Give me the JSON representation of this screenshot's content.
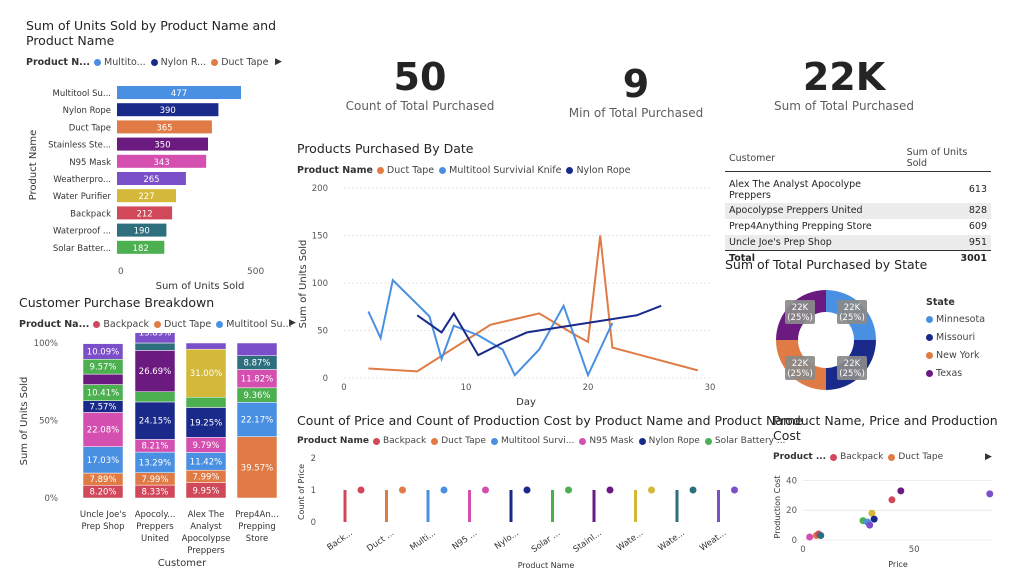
{
  "units_chart": {
    "title": "Sum of Units Sold by Product Name and Product Name",
    "legend_title": "Product N...",
    "legend": [
      {
        "name": "Multito...",
        "color": "#4a90e2"
      },
      {
        "name": "Nylon R...",
        "color": "#1a2a8a"
      },
      {
        "name": "Duct Tape",
        "color": "#e07b45"
      }
    ],
    "xlabel": "Sum of Units Sold",
    "ylabel": "Product Name",
    "ticks": [
      "0",
      "500"
    ]
  },
  "kpis": [
    {
      "value": "50",
      "label": "Count of Total Purchased"
    },
    {
      "value": "9",
      "label": "Min of Total Purchased"
    },
    {
      "value": "22K",
      "label": "Sum of Total Purchased"
    }
  ],
  "line_chart": {
    "title": "Products Purchased By Date",
    "legend_title": "Product Name",
    "legend": [
      {
        "name": "Duct Tape",
        "color": "#e07b45"
      },
      {
        "name": "Multitool Survivial Knife",
        "color": "#4a90e2"
      },
      {
        "name": "Nylon Rope",
        "color": "#1a2a8a"
      }
    ],
    "xlabel": "Day",
    "ylabel": "Sum of Units Sold",
    "yticks": [
      "200",
      "150",
      "100",
      "50",
      "0"
    ],
    "xticks": [
      "0",
      "10",
      "20",
      "30"
    ]
  },
  "customer_table": {
    "headers": [
      "Customer",
      "Sum of Units Sold"
    ],
    "rows": [
      {
        "name": "Alex The Analyst Apocolype Preppers",
        "value": "613"
      },
      {
        "name": "Apocolypse Preppers United",
        "value": "828"
      },
      {
        "name": "Prep4Anything Prepping Store",
        "value": "609"
      },
      {
        "name": "Uncle Joe's Prep Shop",
        "value": "951"
      }
    ],
    "total_label": "Total",
    "total_value": "3001"
  },
  "donut": {
    "title": "Sum of Total Purchased by State",
    "legend_title": "State",
    "labels": [
      {
        "line1": "22K",
        "line2": "(25%)"
      },
      {
        "line1": "22K",
        "line2": "(25%)"
      },
      {
        "line1": "22K",
        "line2": "(25%)"
      },
      {
        "line1": "22K",
        "line2": "(25%)"
      }
    ],
    "legend": [
      {
        "name": "Minnesota",
        "color": "#4a90e2"
      },
      {
        "name": "Missouri",
        "color": "#1a2a8a"
      },
      {
        "name": "New York",
        "color": "#e07b45"
      },
      {
        "name": "Texas",
        "color": "#6b1a80"
      }
    ]
  },
  "stacked": {
    "title": "Customer Purchase Breakdown",
    "legend_title": "Product Na...",
    "legend": [
      {
        "name": "Backpack",
        "color": "#d0485a"
      },
      {
        "name": "Duct Tape",
        "color": "#e07b45"
      },
      {
        "name": "Multitool Su...",
        "color": "#4a90e2"
      }
    ],
    "xlabel": "Customer",
    "ylabel": "Sum of Units Sold",
    "yticks": [
      "100%",
      "50%",
      "0%"
    ],
    "categories": [
      {
        "l1": "Uncle Joe's",
        "l2": "Prep Shop",
        "l3": "",
        "l4": ""
      },
      {
        "l1": "Apocoly...",
        "l2": "Preppers",
        "l3": "United",
        "l4": ""
      },
      {
        "l1": "Alex The",
        "l2": "Analyst",
        "l3": "Apocolypse",
        "l4": "Preppers"
      },
      {
        "l1": "Prep4An...",
        "l2": "Prepping",
        "l3": "Store",
        "l4": ""
      }
    ]
  },
  "count_chart": {
    "title": "Count of Price and Count of Production Cost by Product Name and Product Name",
    "legend_title": "Product Name",
    "legend": [
      {
        "name": "Backpack",
        "color": "#d0485a"
      },
      {
        "name": "Duct Tape",
        "color": "#e07b45"
      },
      {
        "name": "Multitool Survi...",
        "color": "#4a90e2"
      },
      {
        "name": "N95 Mask",
        "color": "#d44fb0"
      },
      {
        "name": "Nylon Rope",
        "color": "#1a2a8a"
      },
      {
        "name": "Solar Battery ...",
        "color": "#4caf50"
      }
    ],
    "xlabel": "Product Name",
    "ylabel": "Count of Price",
    "yticks": [
      "2",
      "1",
      "0"
    ]
  },
  "scatter": {
    "title": "Product Name, Price and Production Cost",
    "legend_title": "Product ...",
    "legend": [
      {
        "name": "Backpack",
        "color": "#d0485a"
      },
      {
        "name": "Duct Tape",
        "color": "#e07b45"
      }
    ],
    "xlabel": "Price",
    "ylabel": "Production Cost",
    "yticks": [
      "40",
      "20",
      "0"
    ],
    "xticks": [
      "0",
      "50"
    ]
  },
  "chart_data": [
    {
      "type": "bar",
      "title": "Sum of Units Sold by Product Name and Product Name",
      "xlabel": "Sum of Units Sold",
      "ylabel": "Product Name",
      "xlim": [
        0,
        550
      ],
      "categories": [
        "Multitool Su...",
        "Nylon Rope",
        "Duct Tape",
        "Stainless Ste...",
        "N95 Mask",
        "Weatherpro...",
        "Water Purifier",
        "Backpack",
        "Waterproof ...",
        "Solar Batter..."
      ],
      "values": [
        477,
        390,
        365,
        350,
        343,
        265,
        227,
        212,
        190,
        182
      ],
      "colors": [
        "#4a90e2",
        "#1a2a8a",
        "#e07b45",
        "#6b1a80",
        "#d44fb0",
        "#7b4fc9",
        "#d4b83a",
        "#d0485a",
        "#2e6f7e",
        "#4caf50"
      ]
    },
    {
      "type": "line",
      "title": "Products Purchased By Date",
      "xlabel": "Day",
      "ylabel": "Sum of Units Sold",
      "xlim": [
        0,
        30
      ],
      "ylim": [
        0,
        200
      ],
      "series": [
        {
          "name": "Duct Tape",
          "color": "#e07b45",
          "x": [
            2,
            6,
            12,
            16,
            19,
            20,
            21,
            22,
            29
          ],
          "y": [
            10,
            7,
            56,
            68,
            45,
            38,
            150,
            32,
            8
          ]
        },
        {
          "name": "Multitool Survivial Knife",
          "color": "#4a90e2",
          "x": [
            2,
            3,
            4,
            7,
            8,
            9,
            11,
            13,
            14,
            16,
            18,
            20,
            22
          ],
          "y": [
            70,
            42,
            103,
            65,
            20,
            55,
            45,
            30,
            3,
            30,
            76,
            3,
            58
          ]
        },
        {
          "name": "Nylon Rope",
          "color": "#1a2a8a",
          "x": [
            6,
            8,
            9,
            11,
            13,
            15,
            20,
            24,
            26
          ],
          "y": [
            66,
            48,
            68,
            24,
            37,
            48,
            58,
            66,
            76
          ]
        }
      ]
    },
    {
      "type": "pie",
      "title": "Sum of Total Purchased by State",
      "categories": [
        "Minnesota",
        "Missouri",
        "New York",
        "Texas"
      ],
      "values": [
        25,
        25,
        25,
        25
      ],
      "colors": [
        "#4a90e2",
        "#1a2a8a",
        "#e07b45",
        "#6b1a80"
      ]
    },
    {
      "type": "bar",
      "title": "Customer Purchase Breakdown",
      "xlabel": "Customer",
      "ylabel": "Sum of Units Sold",
      "ylim": [
        0,
        100
      ],
      "categories": [
        "Uncle Joe's Prep Shop",
        "Apocoly... Preppers United",
        "Alex The Analyst Apocolypse Preppers",
        "Prep4An... Prepping Store"
      ],
      "stacks": [
        [
          {
            "value": 8.2,
            "label": "8.20%",
            "color": "#d0485a"
          },
          {
            "value": 7.89,
            "label": "7.89%",
            "color": "#e07b45"
          },
          {
            "value": 17.03,
            "label": "17.03%",
            "color": "#4a90e2"
          },
          {
            "value": 22.08,
            "label": "22.08%",
            "color": "#d44fb0"
          },
          {
            "value": 7.57,
            "label": "7.57%",
            "color": "#1a2a8a"
          },
          {
            "value": 10.41,
            "label": "10.41%",
            "color": "#4caf50"
          },
          {
            "value": 6.74,
            "label": "",
            "color": "#6b1a80"
          },
          {
            "value": 9.57,
            "label": "9.57%",
            "color": "#4caf50"
          },
          {
            "value": 10.09,
            "label": "10.09%",
            "color": "#7b4fc9"
          }
        ],
        [
          {
            "value": 8.33,
            "label": "8.33%",
            "color": "#d0485a"
          },
          {
            "value": 7.99,
            "label": "7.99%",
            "color": "#e07b45"
          },
          {
            "value": 13.29,
            "label": "13.29%",
            "color": "#4a90e2"
          },
          {
            "value": 8.21,
            "label": "8.21%",
            "color": "#d44fb0"
          },
          {
            "value": 24.15,
            "label": "24.15%",
            "color": "#1a2a8a"
          },
          {
            "value": 6.58,
            "label": "",
            "color": "#4caf50"
          },
          {
            "value": 26.69,
            "label": "26.69%",
            "color": "#6b1a80"
          },
          {
            "value": 4.76,
            "label": "",
            "color": "#2e6f7e"
          },
          {
            "value": 13.89,
            "label": "13.89%",
            "color": "#7b4fc9"
          }
        ],
        [
          {
            "value": 9.95,
            "label": "9.95%",
            "color": "#d0485a"
          },
          {
            "value": 7.99,
            "label": "7.99%",
            "color": "#e07b45"
          },
          {
            "value": 11.42,
            "label": "11.42%",
            "color": "#4a90e2"
          },
          {
            "value": 9.79,
            "label": "9.79%",
            "color": "#d44fb0"
          },
          {
            "value": 19.25,
            "label": "19.25%",
            "color": "#1a2a8a"
          },
          {
            "value": 6.6,
            "label": "",
            "color": "#4caf50"
          },
          {
            "value": 31.0,
            "label": "31.00%",
            "color": "#d4b83a"
          },
          {
            "value": 4.0,
            "label": "",
            "color": "#7b4fc9"
          }
        ],
        [
          {
            "value": 39.57,
            "label": "39.57%",
            "color": "#e07b45"
          },
          {
            "value": 22.17,
            "label": "22.17%",
            "color": "#4a90e2"
          },
          {
            "value": 9.36,
            "label": "9.36%",
            "color": "#4caf50"
          },
          {
            "value": 11.82,
            "label": "11.82%",
            "color": "#d44fb0"
          },
          {
            "value": 8.87,
            "label": "8.87%",
            "color": "#2e6f7e"
          },
          {
            "value": 8.21,
            "label": "",
            "color": "#7b4fc9"
          }
        ]
      ]
    },
    {
      "type": "bar",
      "title": "Count of Price and Count of Production Cost by Product Name and Product Name",
      "xlabel": "Product Name",
      "ylabel": "Count of Price",
      "ylim": [
        0,
        2
      ],
      "categories": [
        "Back...",
        "Duct ...",
        "Multi...",
        "N95 ...",
        "Nylo...",
        "Solar ...",
        "Stainl...",
        "Wate...",
        "Wate...",
        "Weat..."
      ],
      "series": [
        {
          "name": "Count of Price",
          "values": [
            1,
            1,
            1,
            1,
            1,
            1,
            1,
            1,
            1,
            1
          ]
        },
        {
          "name": "Count of Production Cost",
          "values": [
            1,
            1,
            1,
            1,
            1,
            1,
            1,
            1,
            1,
            1
          ]
        }
      ],
      "colors": [
        "#d0485a",
        "#e07b45",
        "#4a90e2",
        "#d44fb0",
        "#1a2a8a",
        "#4caf50",
        "#6b1a80",
        "#d4b83a",
        "#2e6f7e",
        "#7b4fc9"
      ]
    },
    {
      "type": "scatter",
      "title": "Product Name, Price and Production Cost",
      "xlabel": "Price",
      "ylabel": "Production Cost",
      "xlim": [
        0,
        85
      ],
      "ylim": [
        0,
        45
      ],
      "points": [
        {
          "x": 3,
          "y": 2,
          "color": "#d44fb0"
        },
        {
          "x": 6,
          "y": 3,
          "color": "#e07b45"
        },
        {
          "x": 7,
          "y": 4,
          "color": "#d0485a"
        },
        {
          "x": 8,
          "y": 3,
          "color": "#2e6f7e"
        },
        {
          "x": 27,
          "y": 13,
          "color": "#4caf50"
        },
        {
          "x": 29,
          "y": 12,
          "color": "#4a90e2"
        },
        {
          "x": 30,
          "y": 10,
          "color": "#7b4fc9"
        },
        {
          "x": 31,
          "y": 18,
          "color": "#d4b83a"
        },
        {
          "x": 32,
          "y": 14,
          "color": "#1a2a8a"
        },
        {
          "x": 40,
          "y": 27,
          "color": "#d0485a"
        },
        {
          "x": 44,
          "y": 33,
          "color": "#6b1a80"
        },
        {
          "x": 84,
          "y": 31,
          "color": "#7b4fc9"
        }
      ]
    }
  ]
}
